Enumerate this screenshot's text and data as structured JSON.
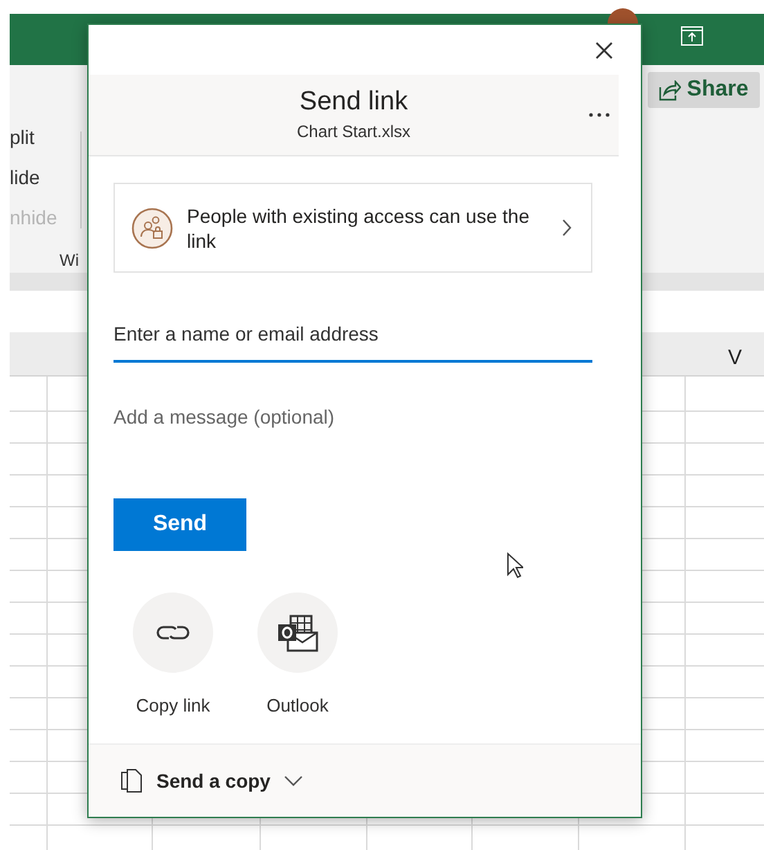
{
  "ribbon": {
    "items": [
      {
        "label": "plit",
        "disabled": false
      },
      {
        "label": "lide",
        "disabled": false
      },
      {
        "label": "nhide",
        "disabled": true
      }
    ],
    "group_label": "Wi",
    "share_button": "Share"
  },
  "sheet": {
    "column_header": "V"
  },
  "dialog": {
    "title": "Send link",
    "subtitle": "Chart Start.xlsx",
    "access_setting": "People with existing access can use the link",
    "recipient_field": {
      "placeholder": "Enter a name or email address"
    },
    "message_field": {
      "placeholder": "Add a message (optional)"
    },
    "send_button": "Send",
    "share_options": [
      {
        "kind": "link",
        "label": "Copy link"
      },
      {
        "kind": "outlook",
        "label": "Outlook"
      }
    ],
    "footer_button": "Send a copy"
  }
}
